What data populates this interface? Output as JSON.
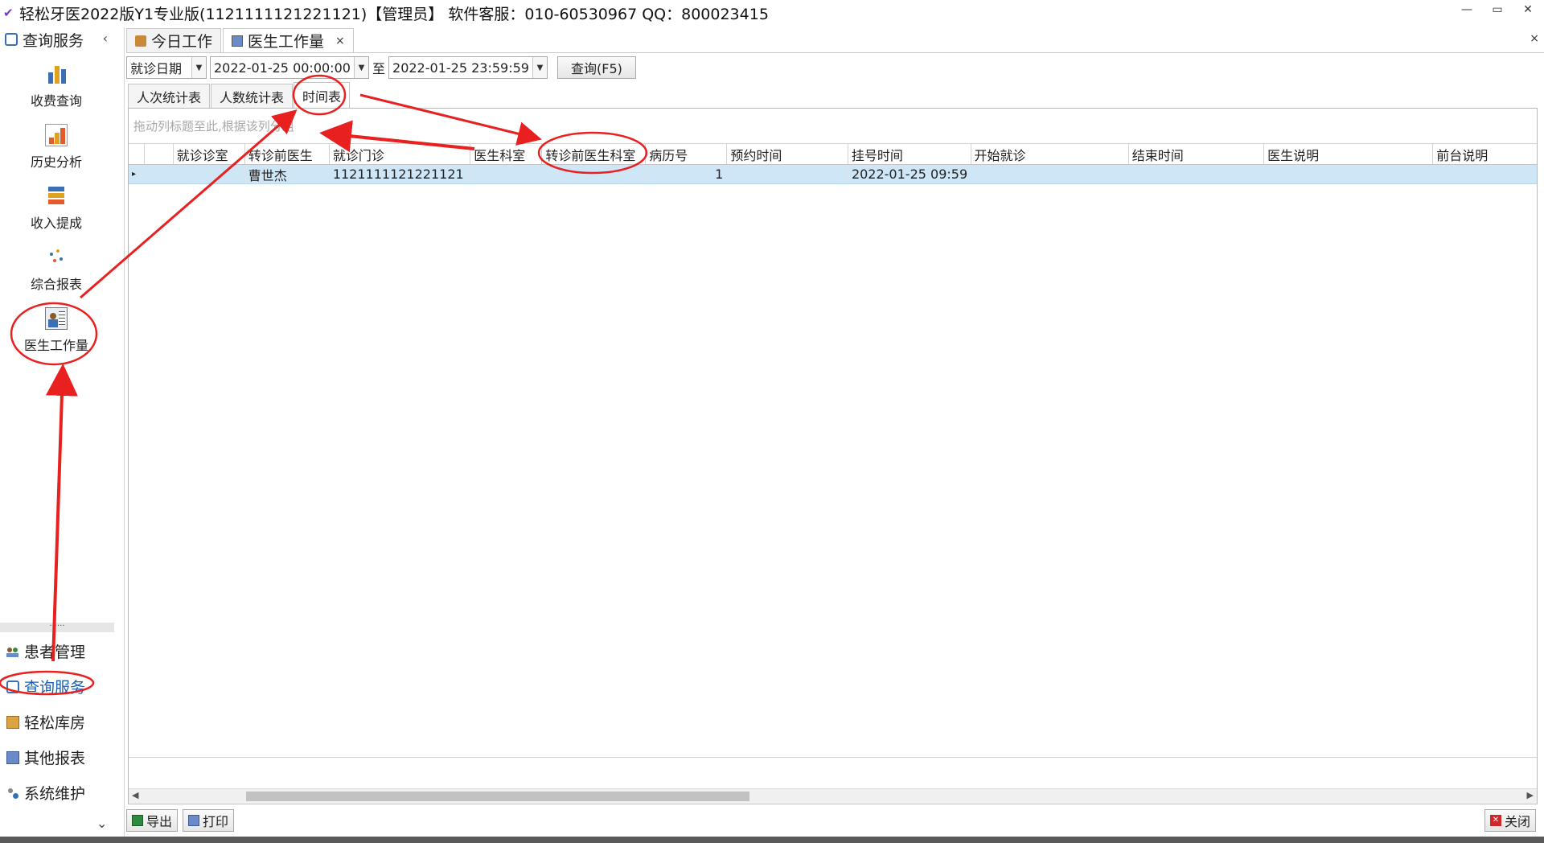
{
  "window": {
    "title": "轻松牙医2022版Y1专业版(1121111121221121)【管理员】   软件客服：010-60530967 QQ：800023415",
    "controls": [
      "—",
      "▭",
      "✕"
    ]
  },
  "sidebar": {
    "header": "查询服务",
    "collapse_symbol": "‹",
    "big_items": [
      {
        "label": "收费查询"
      },
      {
        "label": "历史分析"
      },
      {
        "label": "收入提成"
      },
      {
        "label": "综合报表"
      },
      {
        "label": "医生工作量"
      }
    ],
    "splitter": "......",
    "small_items": [
      {
        "label": "患者管理"
      },
      {
        "label": "查询服务"
      },
      {
        "label": "轻松库房"
      },
      {
        "label": "其他报表"
      },
      {
        "label": "系统维护"
      }
    ],
    "footer_symbol": "⌄"
  },
  "doc_tabs": [
    {
      "label": "今日工作"
    },
    {
      "label": "医生工作量",
      "close": "×"
    }
  ],
  "panel_close": "×",
  "filter": {
    "date_type": "就诊日期",
    "start": "2022-01-25 00:00:00",
    "to": "至",
    "end": "2022-01-25 23:59:59",
    "query_label": "查询(F5)"
  },
  "sub_tabs": [
    {
      "label": "人次统计表"
    },
    {
      "label": "人数统计表"
    },
    {
      "label": "时间表"
    }
  ],
  "grid": {
    "group_hint": "拖动列标题至此,根据该列分组",
    "columns": [
      "就诊诊室",
      "转诊前医生",
      "就诊门诊",
      "医生科室",
      "转诊前医生科室",
      "病历号",
      "预约时间",
      "挂号时间",
      "开始就诊",
      "结束时间",
      "医生说明",
      "前台说明"
    ],
    "rows": [
      [
        "",
        "曹世杰",
        "1121111121221121",
        "",
        "",
        "1",
        "",
        "2022-01-25 09:59",
        "",
        "",
        "",
        ""
      ]
    ],
    "row_indicator": "▸"
  },
  "bottom": {
    "export_label": "导出",
    "print_label": "打印",
    "close_label": "关闭"
  },
  "colors": {
    "selection": "#cfe6f7",
    "accent": "#1a5fb4",
    "annotation": "#e8201f"
  }
}
